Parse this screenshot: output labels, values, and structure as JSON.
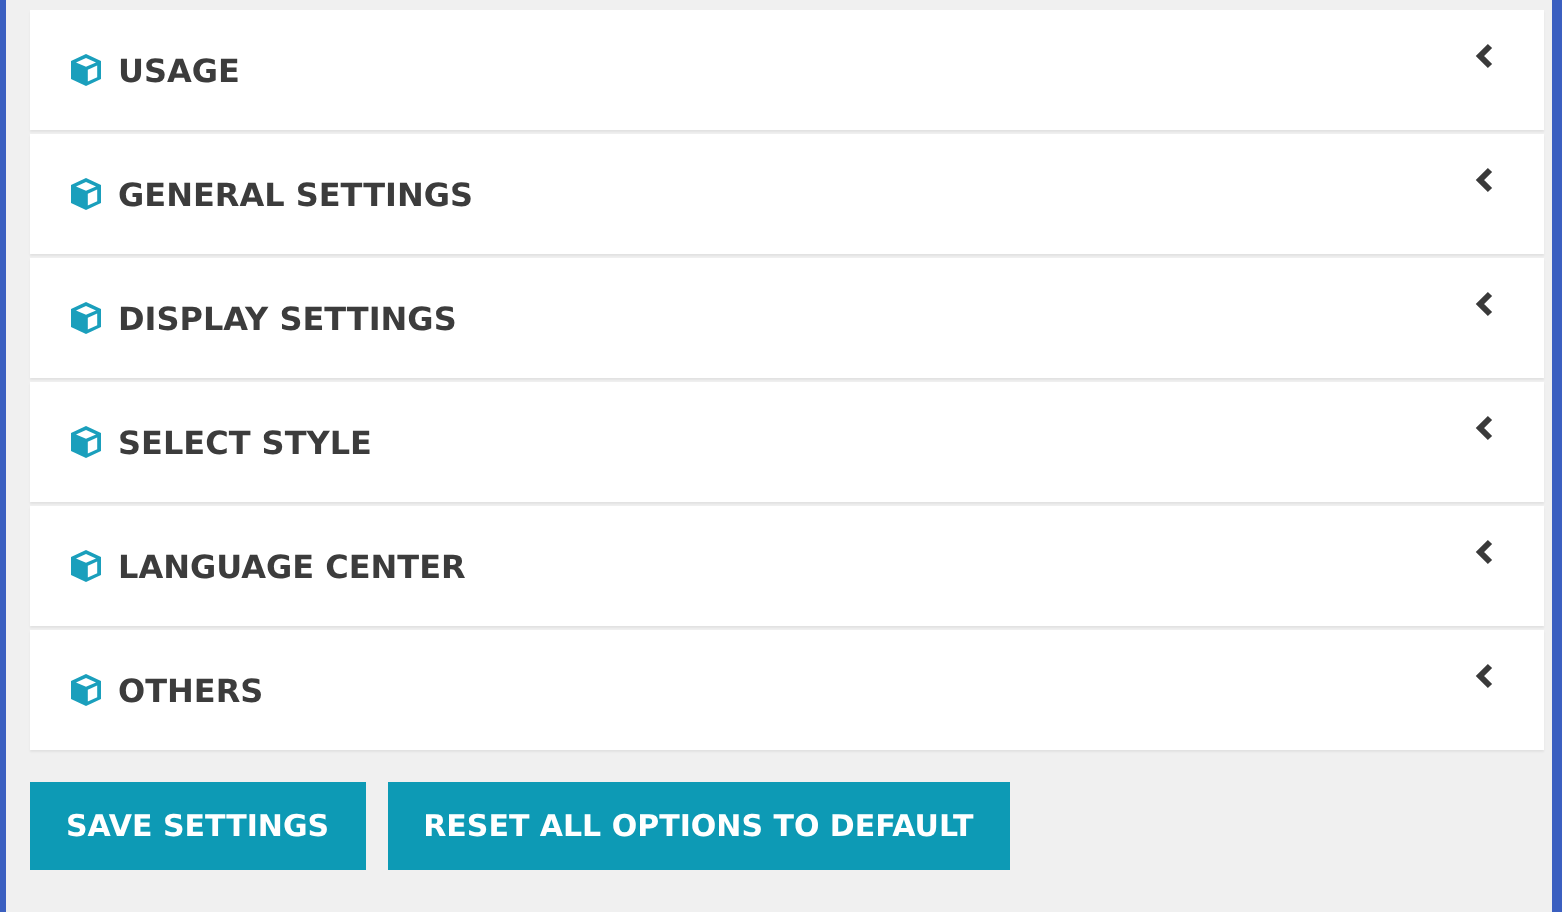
{
  "sections": [
    {
      "title": "USAGE",
      "expanded": false
    },
    {
      "title": "GENERAL SETTINGS",
      "expanded": false
    },
    {
      "title": "DISPLAY SETTINGS",
      "expanded": false
    },
    {
      "title": "SELECT STYLE",
      "expanded": false
    },
    {
      "title": "LANGUAGE CENTER",
      "expanded": false
    },
    {
      "title": "OTHERS",
      "expanded": false
    }
  ],
  "buttons": [
    "SAVE SETTINGS",
    "RESET ALL OPTIONS TO DEFAULT"
  ]
}
